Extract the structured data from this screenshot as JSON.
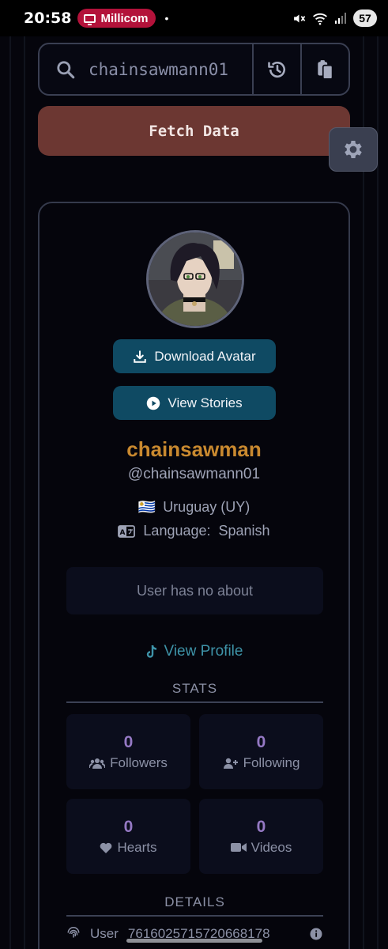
{
  "status_bar": {
    "time": "20:58",
    "carrier": "Millicom",
    "dot": "•",
    "battery": "57"
  },
  "search": {
    "value": "chainsawmann01",
    "placeholder": "chainsawmann01",
    "history_icon": "history-icon",
    "paste_icon": "clipboard-icon"
  },
  "fetch_button_label": "Fetch Data",
  "settings_icon": "gear-icon",
  "profile": {
    "download_avatar_label": "Download Avatar",
    "view_stories_label": "View Stories",
    "display_name": "chainsawman",
    "handle": "@chainsawmann01",
    "flag": "🇺🇾",
    "country": "Uruguay (UY)",
    "language_label": "Language:",
    "language": "Spanish",
    "about": "User has no about",
    "view_profile_label": "View Profile"
  },
  "stats": {
    "title": "STATS",
    "items": [
      {
        "value": "0",
        "label": "Followers",
        "icon": "users-icon"
      },
      {
        "value": "0",
        "label": "Following",
        "icon": "user-plus-icon"
      },
      {
        "value": "0",
        "label": "Hearts",
        "icon": "heart-icon"
      },
      {
        "value": "0",
        "label": "Videos",
        "icon": "video-icon"
      }
    ]
  },
  "details": {
    "title": "DETAILS",
    "row_label": "User",
    "row_value": "7616025715720668178"
  },
  "colors": {
    "background": "#05050c",
    "fetch_button": "#6c3732",
    "action_button": "#0f4a63",
    "display_name": "#c9892f",
    "stat_value": "#9579c4",
    "link": "#3e93a8"
  }
}
